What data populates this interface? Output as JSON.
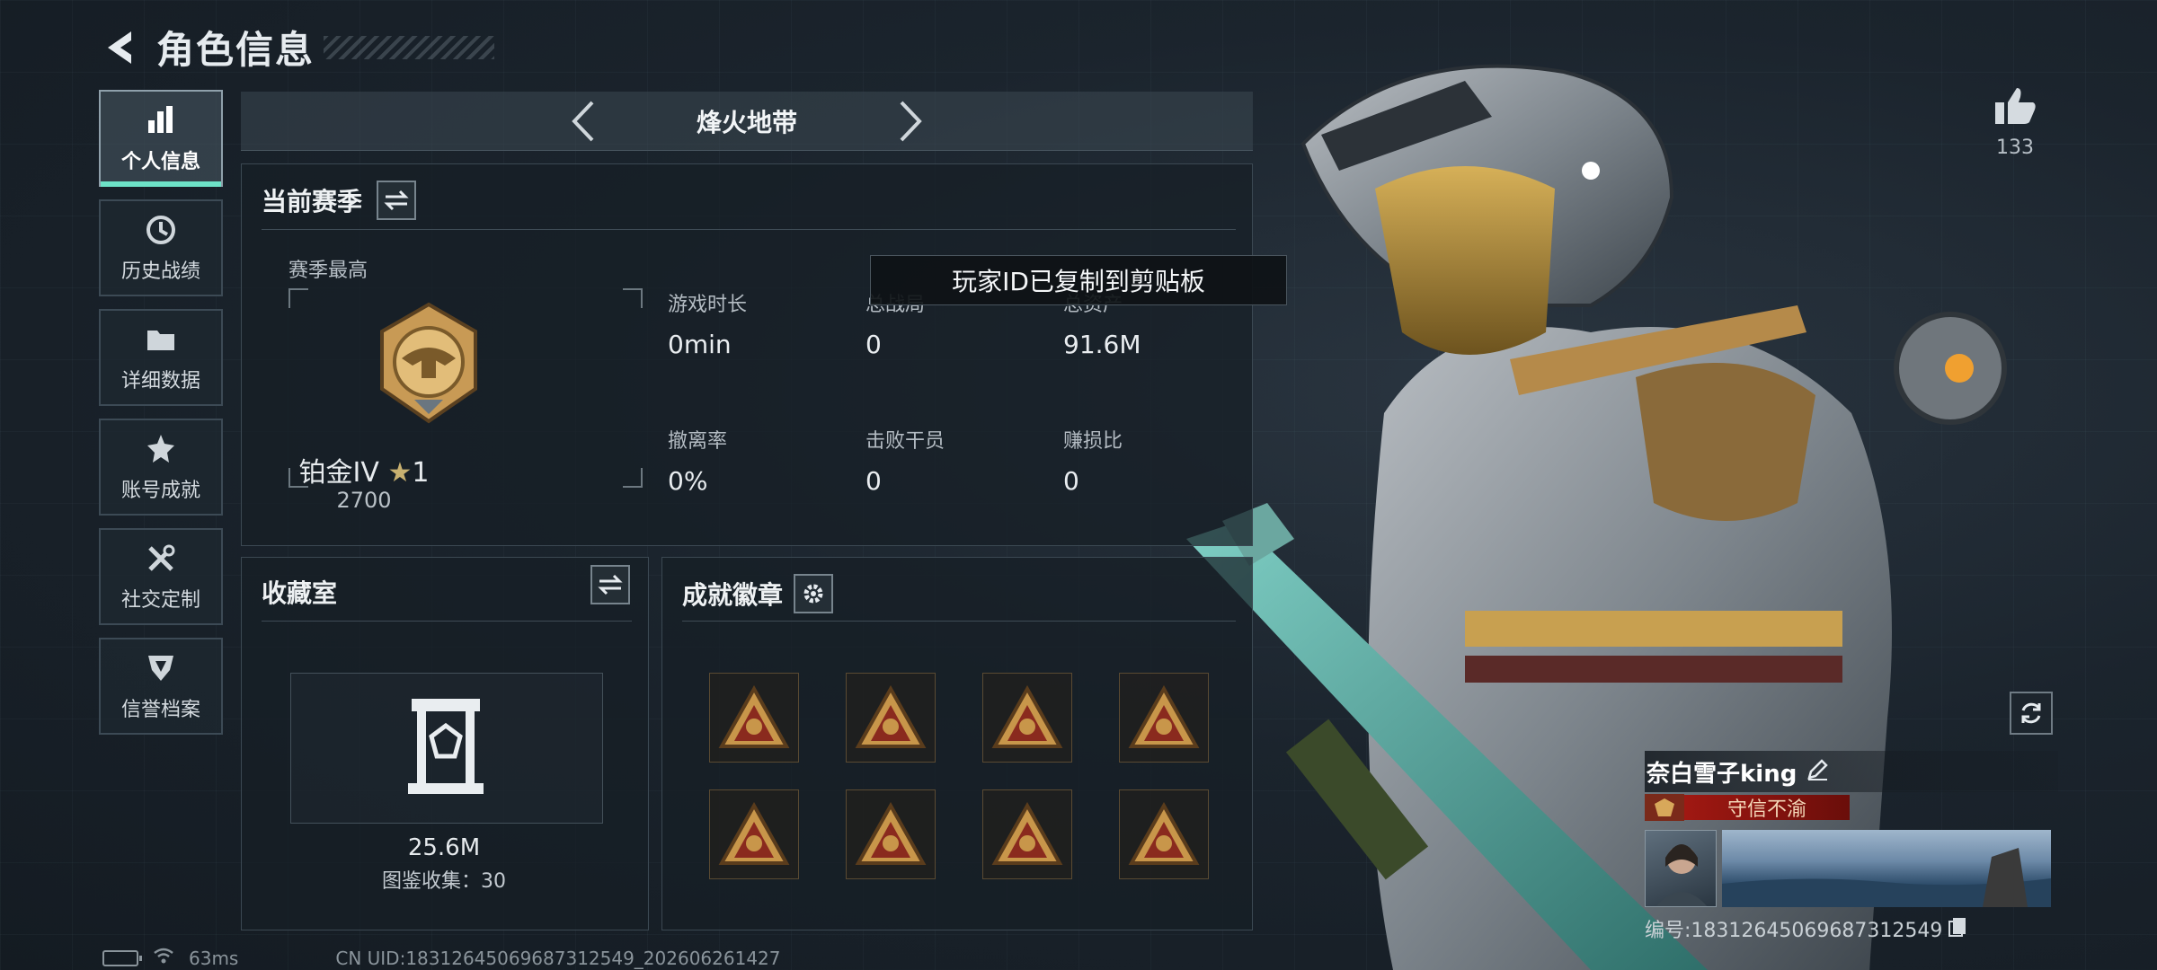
{
  "header": {
    "title": "角色信息"
  },
  "sidebar": {
    "items": [
      {
        "label": "个人信息",
        "icon": "bar-chart-icon",
        "active": true
      },
      {
        "label": "历史战绩",
        "icon": "history-icon"
      },
      {
        "label": "详细数据",
        "icon": "folder-icon"
      },
      {
        "label": "账号成就",
        "icon": "achievement-icon"
      },
      {
        "label": "社交定制",
        "icon": "tools-icon"
      },
      {
        "label": "信誉档案",
        "icon": "shield-icon"
      }
    ]
  },
  "mode": {
    "title": "烽火地带"
  },
  "season": {
    "title": "当前赛季",
    "subtitle": "赛季最高",
    "rank_name": "铂金IV",
    "rank_stars": "1",
    "rank_score": "2700",
    "stats": [
      {
        "label": "游戏时长",
        "value": "0min"
      },
      {
        "label": "总战局",
        "value": "0"
      },
      {
        "label": "总资产",
        "value": "91.6M"
      },
      {
        "label": "撤离率",
        "value": "0%"
      },
      {
        "label": "击败干员",
        "value": "0"
      },
      {
        "label": "赚损比",
        "value": "0"
      }
    ]
  },
  "toast": {
    "text": "玩家ID已复制到剪贴板"
  },
  "collection": {
    "title": "收藏室",
    "value": "25.6M",
    "sub": "图鉴收集：30"
  },
  "badges": {
    "title": "成就徽章",
    "items": [
      "badge-1",
      "badge-2",
      "badge-3",
      "badge-4",
      "badge-5",
      "badge-6",
      "badge-7",
      "badge-8"
    ]
  },
  "like": {
    "count": "133"
  },
  "player": {
    "name": "奈白雪子king",
    "title_tag": "守信不渝",
    "id_text": "编号:18312645069687312549"
  },
  "footer": {
    "ping": "63ms",
    "uid": "CN UID:18312645069687312549_202606261427"
  },
  "colors": {
    "accent": "#6de2c7",
    "title_red": "#a01812",
    "badge_gold": "#c8964a"
  }
}
